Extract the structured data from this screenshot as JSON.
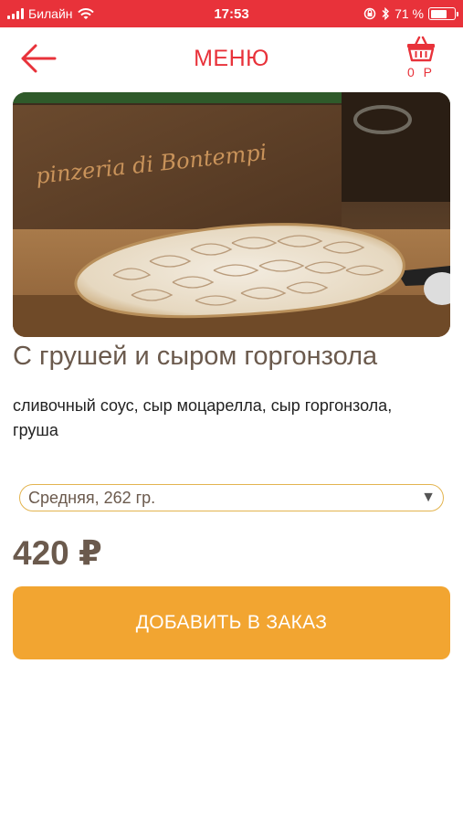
{
  "status_bar": {
    "carrier": "Билайн",
    "time": "17:53",
    "battery_percent": "71 %",
    "battery_level": 0.71
  },
  "header": {
    "title": "МЕНЮ",
    "cart_total": "0 Р"
  },
  "product": {
    "image_sign_text": "pinzeria di Bontempi",
    "title": "С грушей и сыром горгонзола",
    "description": "сливочный соус, сыр моцарелла, сыр горгонзола, груша",
    "size_selected": "Средняя, 262 гр.",
    "price": "420 ₽",
    "add_button_label": "ДОБАВИТЬ В ЗАКАЗ"
  },
  "colors": {
    "accent_red": "#e8323a",
    "button_orange": "#f2a531",
    "title_brown": "#6b5a4d",
    "select_border": "#e3b44f"
  },
  "icons": {
    "back": "arrow-left-icon",
    "cart": "basket-icon",
    "wifi": "wifi-icon",
    "bluetooth": "bluetooth-icon",
    "battery": "battery-icon"
  }
}
